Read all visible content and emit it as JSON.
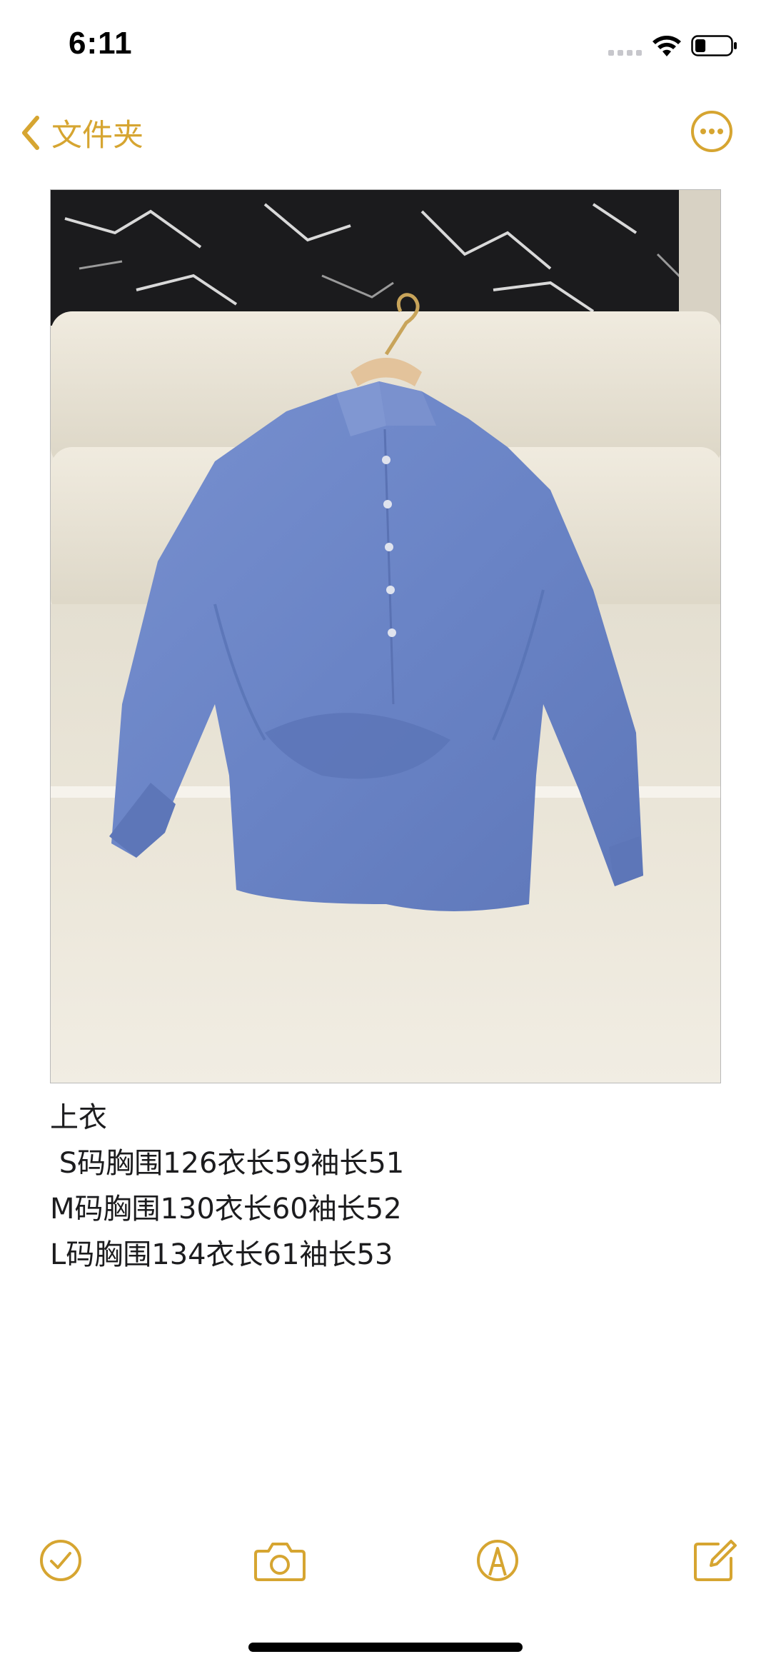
{
  "status_bar": {
    "time": "6:11",
    "battery_percent": 30
  },
  "nav": {
    "back_label": "文件夹",
    "back_icon": "chevron-left-icon",
    "more_icon": "ellipsis-circle-icon"
  },
  "note": {
    "lines": [
      "上衣",
      " S码胸围126衣长59袖长51",
      "M码胸围130衣长60袖长52",
      "L码胸围134衣长61袖长53"
    ]
  },
  "toolbar": {
    "items": [
      "checklist-icon",
      "camera-icon",
      "markup-icon",
      "compose-icon"
    ]
  },
  "colors": {
    "accent": "#d6a531",
    "text": "#1c1c1e",
    "shirt": "#6c86c9"
  }
}
